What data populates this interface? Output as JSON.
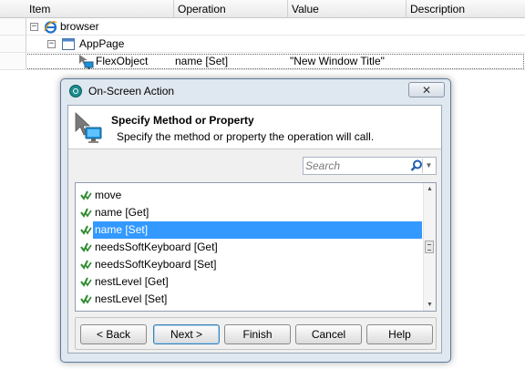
{
  "grid": {
    "columns": [
      "Item",
      "Operation",
      "Value",
      "Description"
    ],
    "tree": [
      {
        "label": "browser",
        "icon": "ie-browser-icon",
        "expander": "−"
      },
      {
        "label": "AppPage",
        "icon": "window-icon",
        "expander": "−"
      },
      {
        "label": "FlexObject",
        "icon": "flex-object-icon",
        "operation": "name [Set]",
        "value": "\"New Window Title\""
      }
    ]
  },
  "dialog": {
    "title": "On-Screen Action",
    "close_label": "✕",
    "heading": "Specify Method or Property",
    "subheading": "Specify the method or property the operation will call.",
    "search_placeholder": "Search",
    "methods": [
      "move",
      "name [Get]",
      "name [Set]",
      "needsSoftKeyboard [Get]",
      "needsSoftKeyboard [Set]",
      "nestLevel [Get]",
      "nestLevel [Set]"
    ],
    "selected_method": "name [Set]",
    "buttons": {
      "back": "< Back",
      "next": "Next >",
      "finish": "Finish",
      "cancel": "Cancel",
      "help": "Help"
    }
  },
  "colors": {
    "selection": "#3399ff",
    "method_icon": "#2e8b2e",
    "title_icon": "#1b8b8b"
  }
}
